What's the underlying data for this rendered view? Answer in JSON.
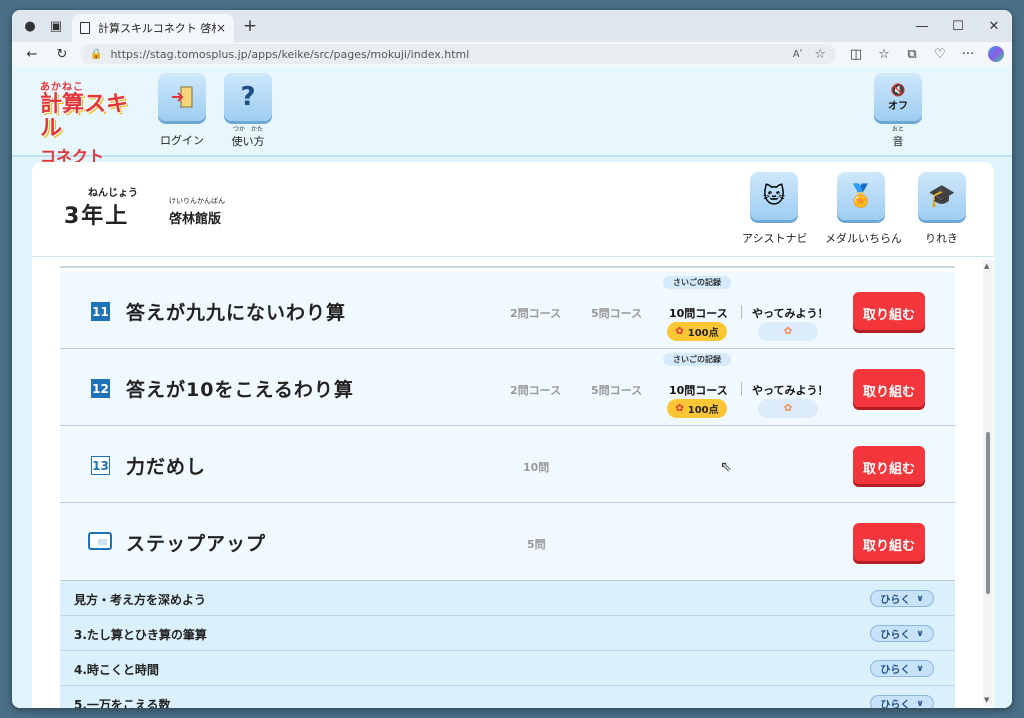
{
  "browser": {
    "tab_title": "計算スキルコネクト 啓林館版",
    "tab_close": "×",
    "new_tab": "+",
    "url": "https://stag.tomosplus.jp/apps/keike/src/pages/mokuji/index.html",
    "read_aloud": "Aʹ",
    "controls": {
      "minimize": "—",
      "maximize": "☐",
      "close": "✕"
    },
    "nav": {
      "back": "←",
      "refresh": "↻"
    },
    "icons": {
      "split": "◫",
      "favorites": "☆",
      "collections": "⧉",
      "extensions": "♡",
      "more": "···",
      "fav_star": "☆",
      "lock": "🔒"
    }
  },
  "header": {
    "logo": {
      "line1": "あかねこ",
      "line2": "計算スキル",
      "line3": "コネクト"
    },
    "login_label": "ログイン",
    "help_label": "使い方",
    "help_ruby": "つか　かた",
    "help_glyph": "?",
    "sound_button": "オフ",
    "sound_label": "音",
    "sound_ruby": "おと"
  },
  "card": {
    "grade": "3年上",
    "grade_ruby": "ねんじょう",
    "publisher": "啓林館版",
    "publisher_ruby": "けいりんかんばん",
    "tools": [
      {
        "label": "アシストナビ",
        "icon": "cat-face-icon"
      },
      {
        "label": "メダルいちらん",
        "icon": "medal-icon"
      },
      {
        "label": "りれき",
        "icon": "graduation-cap-icon"
      }
    ]
  },
  "units": [
    {
      "number": "11",
      "title": "答えが九九にないわり算",
      "course_a": "2問コース",
      "course_b": "5問コース",
      "course_c": "10問コース",
      "record_label": "さいごの記録",
      "try_label": "やってみよう！",
      "score": "100点",
      "button": "取り組む"
    },
    {
      "number": "12",
      "title": "答えが10をこえるわり算",
      "course_a": "2問コース",
      "course_b": "5問コース",
      "course_c": "10問コース",
      "record_label": "さいごの記録",
      "try_label": "やってみよう！",
      "score": "100点",
      "button": "取り組む"
    },
    {
      "number": "13",
      "title": "力だめし",
      "course_a": "10問",
      "button": "取り組む"
    },
    {
      "title": "ステップアップ",
      "course_a": "5問",
      "button": "取り組む"
    }
  ],
  "accordions": [
    {
      "title": "見方・考え方を深めよう",
      "button": "ひらく"
    },
    {
      "title": "3.たし算とひき算の筆算",
      "button": "ひらく"
    },
    {
      "title": "4.時こくと時間",
      "button": "ひらく"
    },
    {
      "title": "5.一万をこえる数",
      "button": "ひらく"
    }
  ],
  "colors": {
    "accent_red": "#f2363b",
    "accent_blue": "#1e73b8",
    "score_yellow": "#fbc633"
  }
}
